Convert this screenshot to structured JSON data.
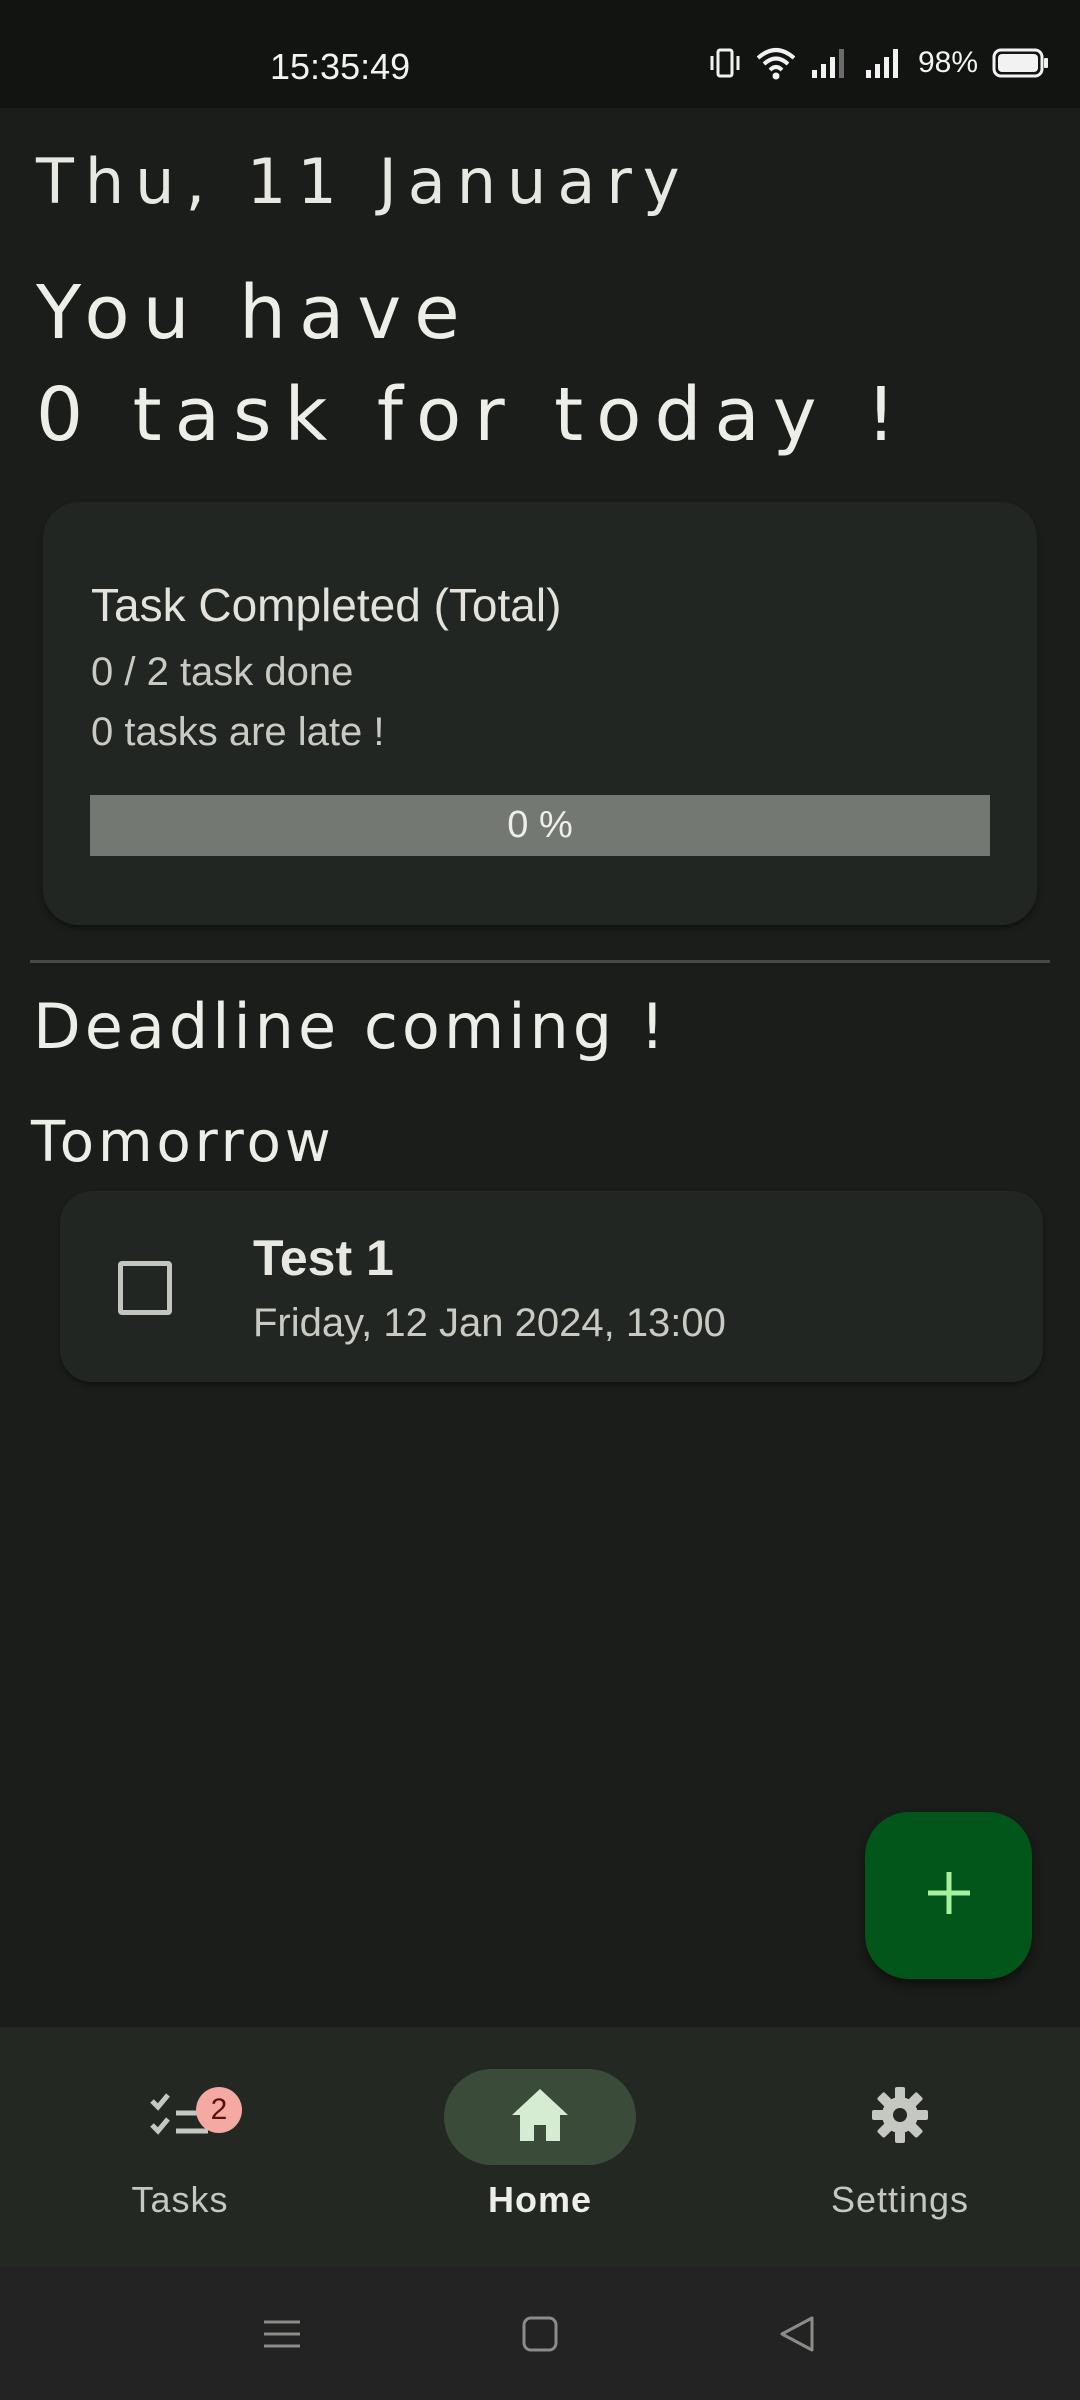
{
  "status_bar": {
    "time": "15:35:49",
    "battery_percent": "98%",
    "icons": [
      "vibrate-icon",
      "wifi-icon",
      "signal-icon",
      "signal-icon",
      "battery-icon"
    ]
  },
  "header": {
    "date": "Thu, 11 January",
    "headline_line1": "You have",
    "headline_line2": "0 task for today !"
  },
  "stats_card": {
    "title": "Task Completed (Total)",
    "done_text": "0 / 2 task done",
    "late_text": "0 tasks are late !",
    "progress_label": "0 %",
    "progress_fraction": 0
  },
  "deadline_section": {
    "title": "Deadline coming !",
    "group_title": "Tomorrow",
    "tasks": [
      {
        "title": "Test 1",
        "date": "Friday, 12 Jan 2024, 13:00",
        "checked": false
      }
    ]
  },
  "fab": {
    "icon": "plus-icon"
  },
  "bottom_nav": {
    "items": [
      {
        "label": "Tasks",
        "icon": "tasks-checklist-icon",
        "badge": "2",
        "active": false
      },
      {
        "label": "Home",
        "icon": "home-icon",
        "active": true
      },
      {
        "label": "Settings",
        "icon": "gear-icon",
        "active": false
      }
    ]
  },
  "system_nav": {
    "icons": [
      "menu-icon",
      "home-square-icon",
      "back-icon"
    ]
  },
  "colors": {
    "background": "#1a1d1a",
    "card": "#222622",
    "fab": "#03561a",
    "fab_icon": "#a6f0a0",
    "active_nav_pill": "#3b4b3a",
    "badge": "#f4a9a3",
    "progress_track": "#737873"
  }
}
